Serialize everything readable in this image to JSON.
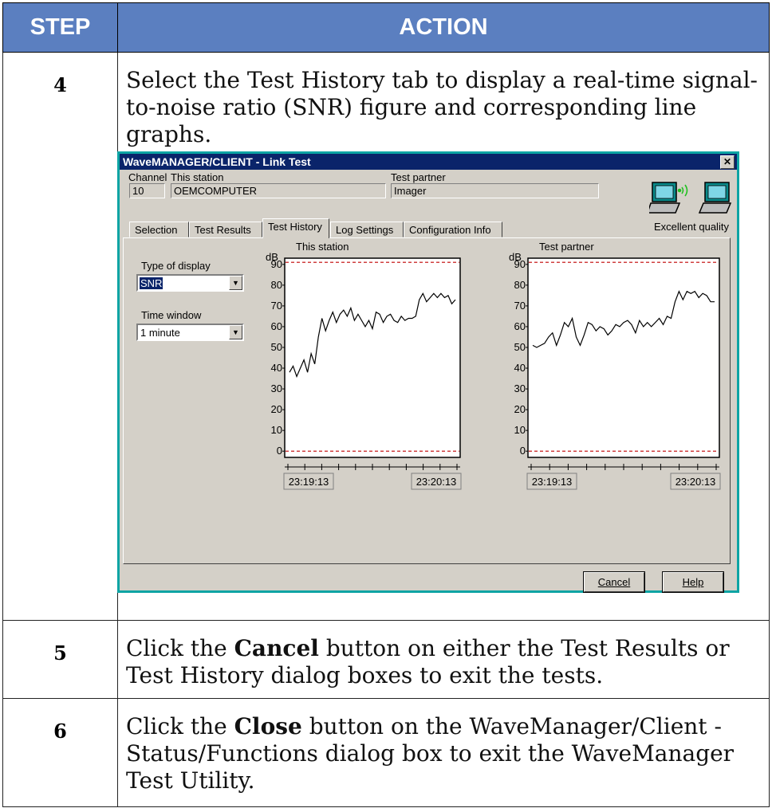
{
  "table": {
    "header_step": "STEP",
    "header_action": "ACTION",
    "rows": [
      {
        "step": "4",
        "text": "Select the Test History tab to display a real-time signal-to-noise ratio (SNR) figure and corresponding line graphs."
      },
      {
        "step": "5",
        "pre": "Click the ",
        "bold": "Cancel",
        "post": " button on either the Test Results or Test History dialog boxes to exit the tests."
      },
      {
        "step": "6",
        "pre": "Click the ",
        "bold": "Close",
        "post": " button on the WaveManager/Client - Status/Functions dialog box to exit the WaveManager Test Utility."
      }
    ]
  },
  "dialog": {
    "title": "WaveMANAGER/CLIENT - Link Test",
    "close_glyph": "✕",
    "channel_label": "Channel",
    "channel_value": "10",
    "this_station_label": "This station",
    "this_station_value": "OEMCOMPUTER",
    "test_partner_label": "Test partner",
    "test_partner_value": "Imager",
    "quality_text": "Excellent quality",
    "tabs": [
      "Selection",
      "Test Results",
      "Test History",
      "Log Settings",
      "Configuration Info"
    ],
    "active_tab": "Test History",
    "type_of_display_label": "Type of display",
    "type_of_display_value": "SNR",
    "time_window_label": "Time window",
    "time_window_value": "1 minute",
    "cancel_label": "Cancel",
    "help_label": "Help",
    "colors": {
      "title_bar": "#0a246a",
      "dialog_face": "#d4d0c8",
      "threshold_line": "#c00000",
      "border": "#0da4a4"
    }
  },
  "chart_data": [
    {
      "type": "line",
      "title": "This station",
      "ylabel": "dB",
      "yticks": [
        90,
        80,
        70,
        60,
        50,
        40,
        30,
        20,
        10,
        0
      ],
      "ylim": [
        -3,
        93
      ],
      "x_tick_labels": [
        "23:19:13",
        "23:20:13"
      ],
      "thresholds": [
        91,
        0
      ],
      "series": [
        {
          "values": [
            38,
            41,
            36,
            40,
            44,
            38,
            47,
            42,
            55,
            64,
            58,
            63,
            67,
            62,
            66,
            68,
            65,
            69,
            63,
            66,
            63,
            60,
            63,
            59,
            67,
            66,
            62,
            65,
            66,
            63,
            62,
            65,
            63,
            64,
            64,
            65,
            73,
            76,
            72,
            74,
            76,
            74,
            76,
            74,
            75,
            71,
            73
          ]
        }
      ]
    },
    {
      "type": "line",
      "title": "Test partner",
      "ylabel": "dB",
      "yticks": [
        90,
        80,
        70,
        60,
        50,
        40,
        30,
        20,
        10,
        0
      ],
      "ylim": [
        -3,
        93
      ],
      "x_tick_labels": [
        "23:19:13",
        "23:20:13"
      ],
      "thresholds": [
        91,
        0
      ],
      "series": [
        {
          "values": [
            51,
            50,
            51,
            52,
            55,
            57,
            51,
            56,
            62,
            60,
            64,
            55,
            51,
            56,
            62,
            61,
            58,
            60,
            59,
            56,
            58,
            61,
            60,
            62,
            63,
            61,
            57,
            63,
            60,
            62,
            60,
            62,
            64,
            61,
            65,
            64,
            72,
            77,
            73,
            77,
            76,
            77,
            74,
            76,
            75,
            72,
            72
          ]
        }
      ]
    }
  ]
}
